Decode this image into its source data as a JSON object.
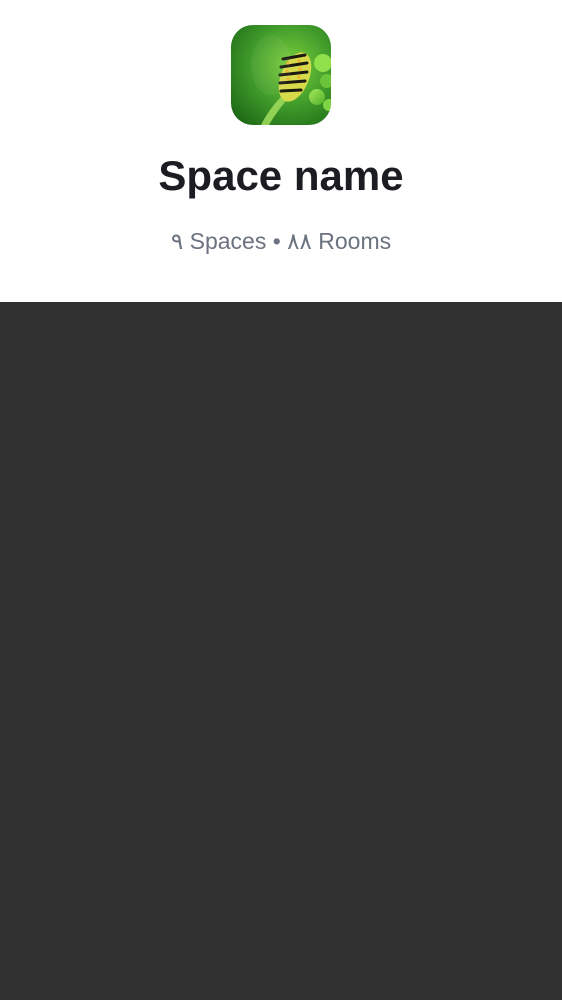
{
  "space": {
    "name": "Space name",
    "spaces_count": "۹",
    "spaces_label": "Spaces",
    "separator": "•",
    "rooms_count": "۸۸",
    "rooms_label": "Rooms"
  },
  "avatar": {
    "icon": "caterpillar-photo",
    "bg_color": "#3f9a2a"
  },
  "colors": {
    "header_bg": "#ffffff",
    "content_bg": "#313131",
    "title": "#1b1d22",
    "meta": "#6b7280"
  }
}
